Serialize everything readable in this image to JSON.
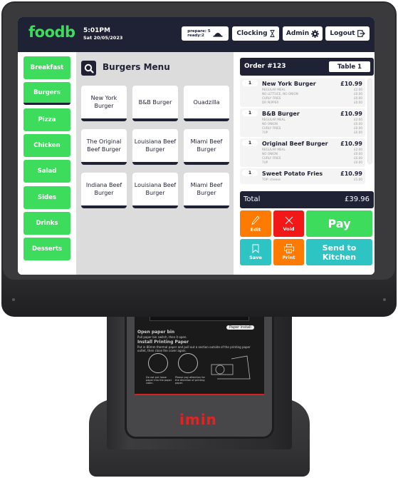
{
  "app": {
    "logo": "foodb",
    "time": "5:01PM",
    "date": "Sat 20/05/2023"
  },
  "toolbar": {
    "prepare_label": "prepare: 5",
    "ready_label": "ready:2",
    "clocking_label": "Clocking",
    "admin_label": "Admin",
    "logout_label": "Logout"
  },
  "sidebar": {
    "items": [
      {
        "label": "Breakfast",
        "active": false
      },
      {
        "label": "Burgers",
        "active": true
      },
      {
        "label": "Pizza",
        "active": false
      },
      {
        "label": "Chicken",
        "active": false
      },
      {
        "label": "Salad",
        "active": false
      },
      {
        "label": "Sides",
        "active": false
      },
      {
        "label": "Drinks",
        "active": false
      },
      {
        "label": "Desserts",
        "active": false
      }
    ]
  },
  "menu": {
    "title": "Burgers Menu",
    "items": [
      "New York Burger",
      "B&B Burger",
      "Ouadzilla",
      "The Original Beef Burger",
      "Louisiana Beef Burger",
      "Miami Beef Burger",
      "Indiana Beef Burger",
      "Louisiana Beef Burger",
      "Miami Beef Burger"
    ]
  },
  "order": {
    "title": "Order #123",
    "table": "Table 1",
    "lines": [
      {
        "qty": "1",
        "name": "New York Burger",
        "price": "£10.99",
        "modifiers": [
          {
            "label": "REGULAR MEAL",
            "price": "£2.00"
          },
          {
            "label": "NO LETTUCE, NO ONION",
            "price": "£0.00"
          },
          {
            "label": "CURLY FRIES",
            "price": "£0.00"
          },
          {
            "label": "DR PEPPER",
            "price": "£0.00"
          }
        ]
      },
      {
        "qty": "1",
        "name": "B&B Burger",
        "price": "£10.99",
        "modifiers": [
          {
            "label": "REGULAR MEAL",
            "price": "£2.00"
          },
          {
            "label": "NO ONION",
            "price": "£0.00"
          },
          {
            "label": "CURLY FRIES",
            "price": "£0.00"
          },
          {
            "label": "7UP",
            "price": "£0.00"
          }
        ]
      },
      {
        "qty": "1",
        "name": "Original Beef Burger",
        "price": "£10.99",
        "modifiers": [
          {
            "label": "REGULAR MEAL",
            "price": "£2.00"
          },
          {
            "label": "NO ONION",
            "price": "£0.00"
          },
          {
            "label": "CURLY FRIES",
            "price": "£0.00"
          },
          {
            "label": "7UP",
            "price": "£0.00"
          }
        ]
      },
      {
        "qty": "1",
        "name": "Sweet Potato Fries",
        "price": "£10.99",
        "modifiers": [
          {
            "label": "TOP: cheese",
            "price": "£1.00"
          }
        ]
      }
    ],
    "total_label": "Total",
    "total_value": "£39.96"
  },
  "actions": {
    "edit": "Edit",
    "void": "Void",
    "pay": "Pay",
    "save": "Save",
    "print": "Print",
    "send_line1": "Send to",
    "send_line2": "Kitchen"
  },
  "device": {
    "brand": "imin",
    "paper_tag": "Paper install",
    "instructions": [
      "Open paper bin",
      "Pull paper bin switch, then it open.",
      "Install Printing Paper",
      "Put in 80mm thermal paper and pull out a section outside of the printing paper outlet, then close the cover again.",
      "Do not put loose paper into the paper cabin.",
      "Please pay attention for the direction of printing paper."
    ]
  },
  "colors": {
    "navy": "#1f2135",
    "green": "#3ddc5c",
    "orange": "#ff7a00",
    "red": "#f21818",
    "teal": "#2ec4c4",
    "brand_red": "#e02424"
  }
}
